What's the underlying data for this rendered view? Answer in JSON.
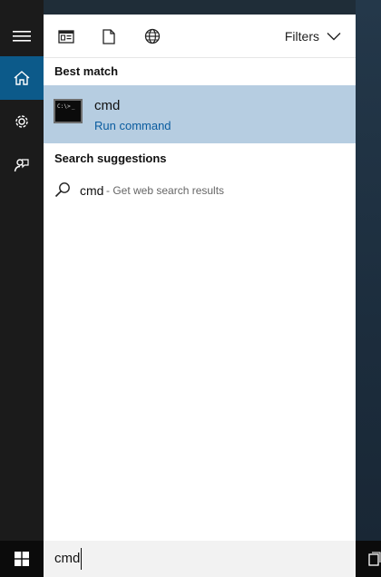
{
  "rail": {
    "items": [
      {
        "icon": "menu-icon"
      },
      {
        "icon": "home-icon"
      },
      {
        "icon": "settings-icon"
      },
      {
        "icon": "feedback-icon"
      }
    ]
  },
  "toolbar": {
    "filters_label": "Filters"
  },
  "best_match": {
    "section_title": "Best match",
    "title": "cmd",
    "subtitle": "Run command",
    "icon_prompt": "C:\\>"
  },
  "suggestions": {
    "section_title": "Search suggestions",
    "items": [
      {
        "term": "cmd",
        "hint": "- Get web search results"
      }
    ]
  },
  "search": {
    "value": "cmd"
  },
  "colors": {
    "selected": "#b6cde1",
    "accent": "#0a5c9f",
    "rail_active": "#0c5a8a"
  }
}
